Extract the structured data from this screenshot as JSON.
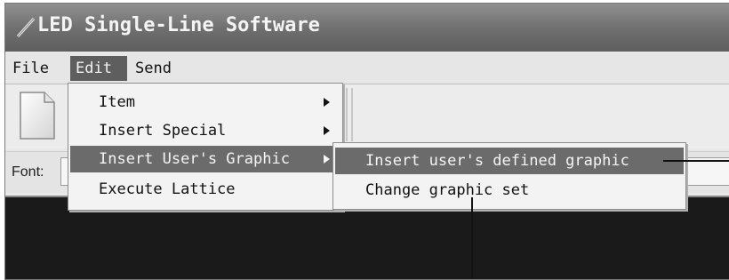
{
  "window": {
    "title": "LED Single-Line Software"
  },
  "menubar": {
    "file": "File",
    "edit": "Edit",
    "send": "Send"
  },
  "fontbar": {
    "label": "Font:"
  },
  "edit_menu": {
    "items": [
      {
        "label": "Item",
        "has_submenu": true
      },
      {
        "label": "Insert Special",
        "has_submenu": true
      },
      {
        "label": "Insert User's Graphic",
        "has_submenu": true,
        "highlighted": true
      },
      {
        "label": "Execute Lattice",
        "has_submenu": false
      }
    ]
  },
  "submenu": {
    "items": [
      {
        "label": "Insert user's defined graphic",
        "highlighted": true
      },
      {
        "label": "Change graphic set"
      }
    ]
  },
  "icons": {
    "app": "pen-icon",
    "new_document": "new-document-icon",
    "submenu_arrow": "chevron-right-icon"
  },
  "colors": {
    "titlebar": "#6e6e6e",
    "highlight": "#6b6b6b",
    "display": "#1a1a1a"
  }
}
